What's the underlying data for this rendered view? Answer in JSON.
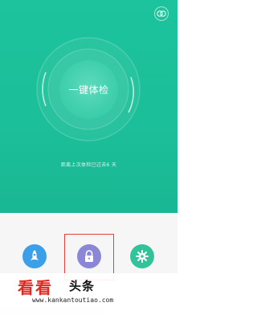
{
  "main": {
    "check_button_label": "一键体检",
    "last_check_text": "距离上次体检已过去6 天"
  },
  "toolbar": {
    "items": [
      {
        "icon": "rocket-icon"
      },
      {
        "icon": "lock-icon"
      },
      {
        "icon": "gear-icon"
      }
    ]
  },
  "watermark": {
    "logo_text": "看看",
    "name": "头条",
    "url": "www.kankantoutiao.com"
  },
  "colors": {
    "primary": "#1cc39c",
    "rocket": "#3ba0e8",
    "lock": "#8c86d6",
    "gear": "#33c39a",
    "highlight": "#e2423c",
    "watermark_red": "#e2281f"
  }
}
